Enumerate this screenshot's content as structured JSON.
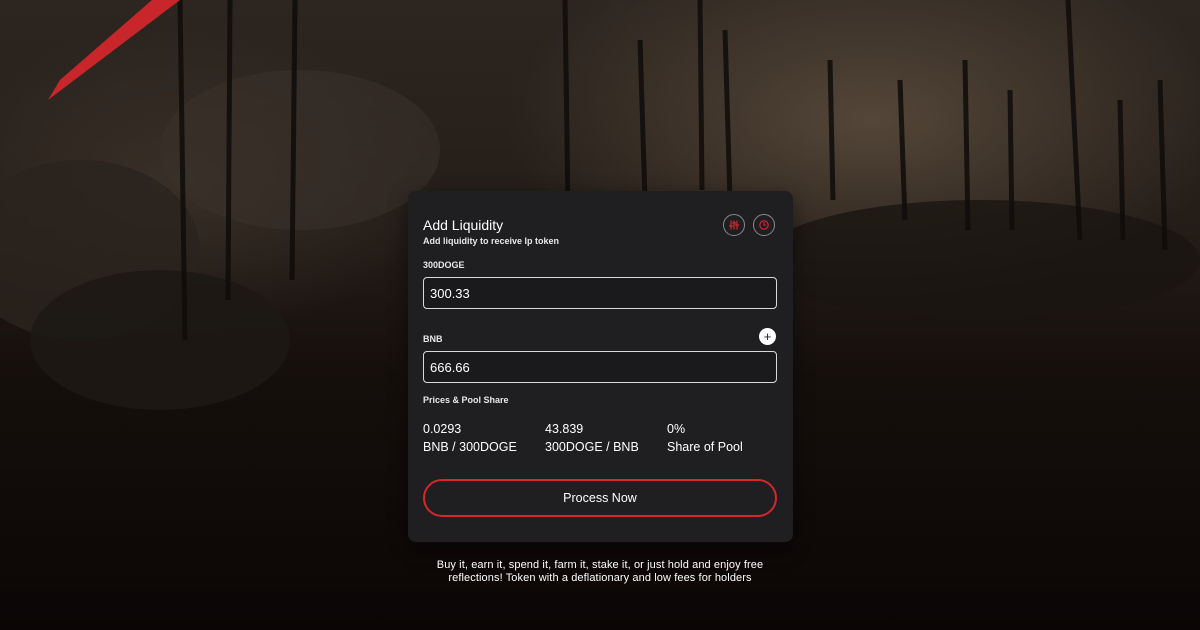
{
  "theme": {
    "accent": "#d4262b",
    "card_background": "#1f1f22",
    "page_background": "#1a1412"
  },
  "card": {
    "title": "Add Liquidity",
    "subtitle": "Add liquidity to receive lp token",
    "settings_icon": "settings-sliders-icon",
    "history_icon": "history-clock-icon"
  },
  "token_a": {
    "label": "300DOGE",
    "value": "300.33"
  },
  "token_b": {
    "label": "BNB",
    "value": "666.66"
  },
  "add_icon": "plus-icon",
  "prices": {
    "heading": "Prices & Pool Share",
    "items": [
      {
        "value": "0.0293",
        "label": "BNB / 300DOGE"
      },
      {
        "value": "43.839",
        "label": "300DOGE / BNB"
      },
      {
        "value": "0%",
        "label": "Share of Pool"
      }
    ]
  },
  "action": {
    "label": "Process Now"
  },
  "tagline": "Buy it, earn it, spend it, farm it, stake it, or just hold and enjoy free reflections! Token with a deflationary and low fees for holders"
}
